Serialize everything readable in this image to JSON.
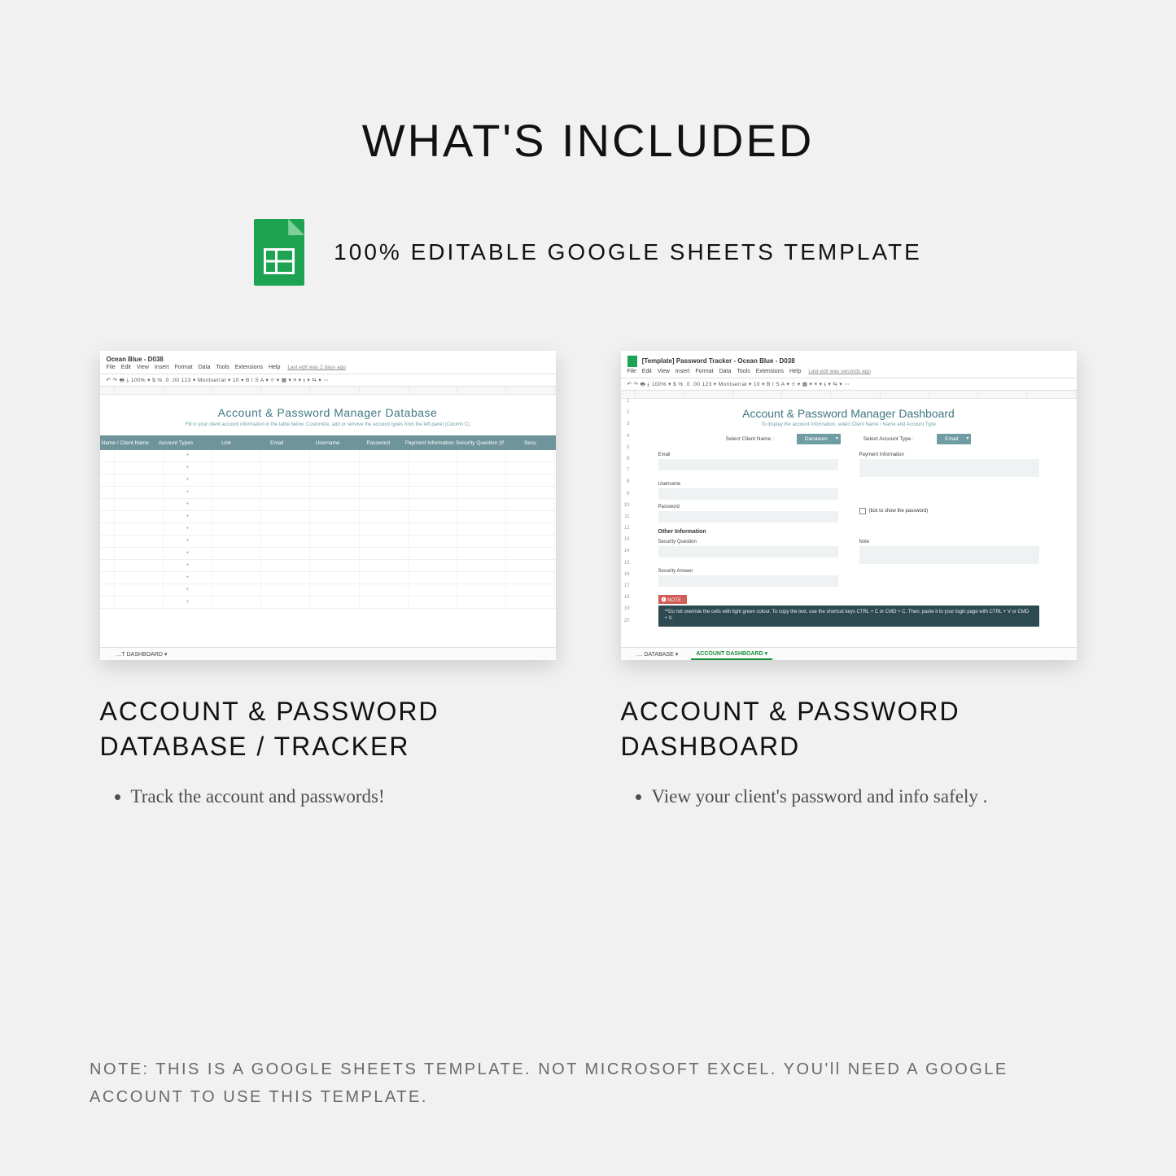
{
  "heading": "WHAT'S INCLUDED",
  "subtitle": "100% EDITABLE GOOGLE SHEETS TEMPLATE",
  "left": {
    "doc_title": "Ocean Blue - D038",
    "menu": [
      "File",
      "Edit",
      "View",
      "Insert",
      "Format",
      "Data",
      "Tools",
      "Extensions",
      "Help"
    ],
    "edit_note": "Last edit was 2 days ago",
    "toolbar": "↶ ↷ 🖶 ⤓ 100% ▾  $ % .0 .00 123 ▾  Montserrat ▾  10 ▾  B I S A ▾ ⯐ ▾ ▦ ▾ ≡ ▾ ⭳ ▾ ⇆ ▾ ⋯",
    "banner_title": "Account & Password Manager Database",
    "banner_sub": "Fill in your client account information in the table below. Customize, add or remove the account types from the left panel (Column C)",
    "headers": [
      "Name / Client Name",
      "Account Types",
      "Link",
      "Email",
      "Username",
      "Password",
      "Payment Information",
      "Security Question (If Any)",
      "Secu"
    ],
    "row_marker": "+",
    "bottom_tabs": [
      "…T DASHBOARD ▾"
    ],
    "caption_title": "ACCOUNT & PASSWORD DATABASE / TRACKER",
    "bullet": "Track the account and passwords!"
  },
  "right": {
    "doc_title": "[Template] Password Tracker - Ocean Blue - D038",
    "menu": [
      "File",
      "Edit",
      "View",
      "Insert",
      "Format",
      "Data",
      "Tools",
      "Extensions",
      "Help"
    ],
    "edit_note": "Last edit was seconds ago",
    "toolbar": "↶ ↷ 🖶 ⤓ 100% ▾  $ % .0 .00 123 ▾  Montserrat ▾  10 ▾  B I S A ▾ ⯐ ▾ ▦ ▾ ≡ ▾ ⭳ ▾ ⇆ ▾ ⋯",
    "banner_title": "Account & Password Manager Dashboard",
    "banner_sub": "To display the account information, select Client Name / Name and Account Type",
    "select_client_label": "Select Client Name :",
    "select_client_value": "Danaleen",
    "select_type_label": "Select Account Type :",
    "select_type_value": "Email",
    "fields": {
      "email": "Email",
      "payment": "Payment Information",
      "username": "Username",
      "password": "Password",
      "checkbox": "(tick to show the password)",
      "other_info": "Other Information",
      "sec_q": "Security Question",
      "note": "Note",
      "sec_a": "Security Answer"
    },
    "note_flag": "🅘 NOTE :",
    "note_text": "**Do not override the cells with light green colour. To copy the text, use the shortcut keys CTRL + C or CMD + C. Then, paste it to your login page with CTRL + V or CMD + V.",
    "bottom_tabs": [
      "… DATABASE ▾",
      "ACCOUNT DASHBOARD ▾"
    ],
    "caption_title": "ACCOUNT & PASSWORD DASHBOARD",
    "bullet": "View your client's password and info safely ."
  },
  "footer": "NOTE: THIS IS A GOOGLE SHEETS TEMPLATE. NOT MICROSOFT EXCEL. YOU'll NEED A GOOGLE ACCOUNT TO USE THIS TEMPLATE."
}
